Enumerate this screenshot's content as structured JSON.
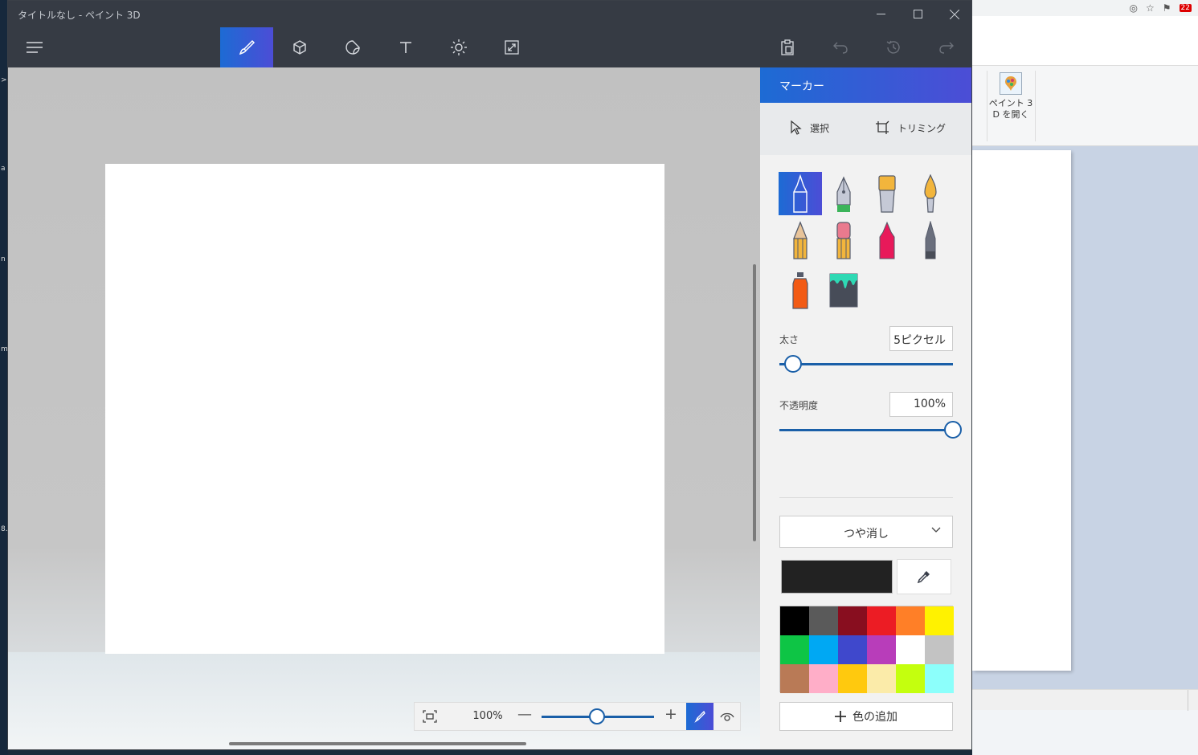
{
  "window": {
    "title": "タイトルなし - ペイント 3D"
  },
  "background_app": {
    "paint3d_button_line1": "ペイント 3",
    "paint3d_button_line2": "D を開く",
    "notification_count": "22"
  },
  "toolbar": {
    "menu_icon": "hamburger-icon",
    "tools": [
      {
        "name": "brushes",
        "icon": "brush-icon",
        "active": true
      },
      {
        "name": "3d-shapes",
        "icon": "cube-icon"
      },
      {
        "name": "stickers",
        "icon": "sticker-icon"
      },
      {
        "name": "text",
        "icon": "text-icon"
      },
      {
        "name": "effects",
        "icon": "sun-icon"
      },
      {
        "name": "canvas",
        "icon": "resize-icon"
      }
    ],
    "right": [
      "paste-icon",
      "undo-icon",
      "history-icon",
      "redo-icon"
    ]
  },
  "panel": {
    "title": "マーカー",
    "select_label": "選択",
    "crop_label": "トリミング",
    "brushes": [
      "marker",
      "calligraphy-pen",
      "oil-brush",
      "watercolor",
      "pencil",
      "eraser",
      "crayon",
      "pixel-pen",
      "spray-can",
      "fill"
    ],
    "thickness_label": "太さ",
    "thickness_value": "5ピクセル",
    "thickness_level": 0.08,
    "opacity_label": "不透明度",
    "opacity_value": "100%",
    "opacity_level": 1.0,
    "finish_label": "つや消し",
    "current_color": "#222222",
    "palette": [
      "#000000",
      "#5a5a5a",
      "#880e1f",
      "#ec1c24",
      "#ff7f27",
      "#fff200",
      "#0ec545",
      "#00a8f3",
      "#3f48cc",
      "#b83dba",
      "#ffffff",
      "#c3c3c3",
      "#b97a56",
      "#ffaec8",
      "#ffc90e",
      "#fbeba9",
      "#c4ff0e",
      "#8cfffb"
    ],
    "add_color_label": "色の追加"
  },
  "zoom": {
    "value": "100%",
    "level": 0.5
  }
}
